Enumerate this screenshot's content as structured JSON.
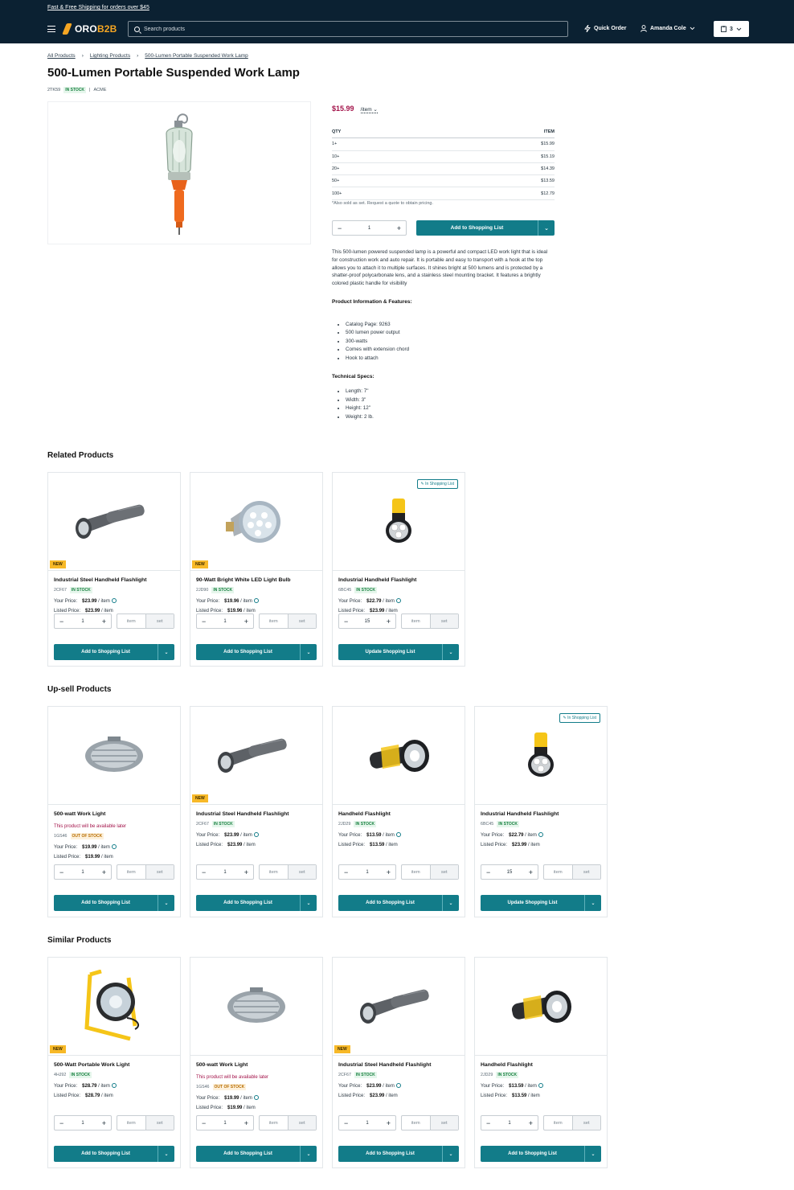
{
  "header": {
    "promo": "Fast & Free Shipping for orders over $45",
    "logo_a": "ORO",
    "logo_b": "B2B",
    "search_placeholder": "Search products",
    "quick_order": "Quick Order",
    "user_name": "Amanda Cole",
    "cart_count": "3"
  },
  "breadcrumbs": [
    "All Products",
    "Lighting Products",
    "500-Lumen Portable Suspended Work Lamp"
  ],
  "product": {
    "title": "500-Lumen Portable Suspended Work Lamp",
    "sku": "2TK59",
    "stock": "IN STOCK",
    "brand": "ACME",
    "price": "$15.99",
    "unit": "/item",
    "tier_head": {
      "qty": "QTY",
      "item": "ITEM"
    },
    "tiers": [
      {
        "qty": "1+",
        "price": "$15.99"
      },
      {
        "qty": "10+",
        "price": "$15.19"
      },
      {
        "qty": "20+",
        "price": "$14.39"
      },
      {
        "qty": "50+",
        "price": "$13.59"
      },
      {
        "qty": "100+",
        "price": "$12.79"
      }
    ],
    "note": "*Also sold as set. Request a quote to obtain pricing.",
    "qty": "1",
    "add_label": "Add to Shopping List",
    "description": "This 500-lumen powered suspended lamp is a powerful and compact LED work light that is ideal for construction work and auto repair. It is portable and easy to transport with a hook at the top allows you to attach it to multiple surfaces. It shines bright at 500 lumens and is protected by a shatter-proof polycarbonate lens, and a stainless steel mounting bracket. It features a brightly colored plastic handle for visibility",
    "features_title": "Product Information & Features:",
    "features": [
      "Catalog Page: 9263",
      "500 lumen power output",
      "300-watts",
      "Comes with extension chord",
      "Hook to attach"
    ],
    "specs_title": "Technical Specs:",
    "specs": [
      "Length: 7\"",
      "Width: 3\"",
      "Height: 12\"",
      "Weight: 2 lb."
    ]
  },
  "labels": {
    "your_price": "Your Price:",
    "listed_price": "Listed Price:",
    "per_item": "/ item",
    "unit_item": "item",
    "unit_set": "set",
    "in_list": "In Shopping List",
    "new": "NEW",
    "later": "This product will be available later"
  },
  "related": {
    "title": "Related Products",
    "items": [
      {
        "name": "Industrial Steel Handheld Flashlight",
        "sku": "2CF67",
        "stock": "IN STOCK",
        "your_price": "$23.99",
        "listed_price": "$23.99",
        "qty": "1",
        "button": "Add to Shopping List"
      },
      {
        "name": "90-Watt Bright White LED Light Bulb",
        "sku": "2JD90",
        "stock": "IN STOCK",
        "your_price": "$19.96",
        "listed_price": "$19.96",
        "qty": "1",
        "button": "Add to Shopping List"
      },
      {
        "name": "Industrial Handheld Flashlight",
        "sku": "6BC45",
        "stock": "IN STOCK",
        "your_price": "$22.79",
        "listed_price": "$23.99",
        "qty": "15",
        "button": "Update Shopping List"
      }
    ]
  },
  "upsell": {
    "title": "Up-sell Products",
    "items": [
      {
        "name": "500-watt Work Light",
        "sku": "1GS46",
        "stock": "OUT OF STOCK",
        "your_price": "$19.99",
        "listed_price": "$19.99",
        "qty": "1",
        "button": "Add to Shopping List"
      },
      {
        "name": "Industrial Steel Handheld Flashlight",
        "sku": "2CF67",
        "stock": "IN STOCK",
        "your_price": "$23.99",
        "listed_price": "$23.99",
        "qty": "1",
        "button": "Add to Shopping List"
      },
      {
        "name": "Handheld Flashlight",
        "sku": "2JD29",
        "stock": "IN STOCK",
        "your_price": "$13.59",
        "listed_price": "$13.59",
        "qty": "1",
        "button": "Add to Shopping List"
      },
      {
        "name": "Industrial Handheld Flashlight",
        "sku": "6BC45",
        "stock": "IN STOCK",
        "your_price": "$22.79",
        "listed_price": "$23.99",
        "qty": "15",
        "button": "Update Shopping List"
      }
    ]
  },
  "similar": {
    "title": "Similar Products",
    "items": [
      {
        "name": "500-Watt Portable Work Light",
        "sku": "4HJ92",
        "stock": "IN STOCK",
        "your_price": "$28.79",
        "listed_price": "$28.79",
        "qty": "1",
        "button": "Add to Shopping List"
      },
      {
        "name": "500-watt Work Light",
        "sku": "1GS46",
        "stock": "OUT OF STOCK",
        "your_price": "$19.99",
        "listed_price": "$19.99",
        "qty": "1",
        "button": "Add to Shopping List"
      },
      {
        "name": "Industrial Steel Handheld Flashlight",
        "sku": "2CF67",
        "stock": "IN STOCK",
        "your_price": "$23.99",
        "listed_price": "$23.99",
        "qty": "1",
        "button": "Add to Shopping List"
      },
      {
        "name": "Handheld Flashlight",
        "sku": "2JD29",
        "stock": "IN STOCK",
        "your_price": "$13.59",
        "listed_price": "$13.59",
        "qty": "1",
        "button": "Add to Shopping List"
      }
    ]
  },
  "colors": {
    "header": "#0b2132",
    "accent": "#127c89",
    "price": "#a3134a",
    "new_badge": "#f7b928",
    "logo": "#f5a623"
  }
}
